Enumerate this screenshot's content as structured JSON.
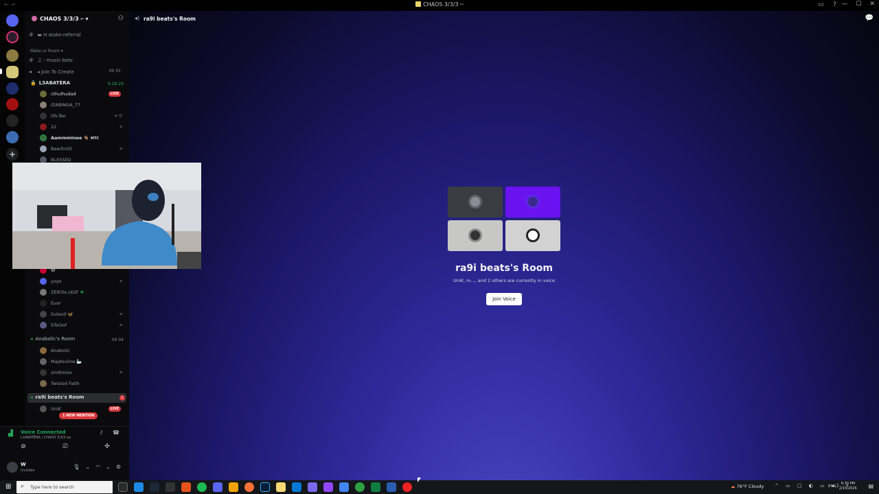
{
  "window": {
    "title": "CHAOS 3/3/3",
    "title_suffix": "ᵖˢ"
  },
  "server": {
    "name": "CHAOS 3/3/3",
    "name_suffix": "ᵖˢ",
    "channels": [
      {
        "icon": "#",
        "label": "stake-referral",
        "prefix": "H"
      },
      {
        "category": "Make ur Room"
      },
      {
        "icon": "#",
        "label": "music-bots"
      },
      {
        "icon": "speaker",
        "label": "Join To Create",
        "counts": "00 01"
      }
    ],
    "voice_channels": [
      {
        "name": "L3ABATÉRA",
        "timer": "9:28:29",
        "members": [
          {
            "name": "cthulhudad",
            "live": "LIVE"
          },
          {
            "name": "IZABINGA_77"
          },
          {
            "name": "Oh-Teo"
          },
          {
            "name": "22"
          },
          {
            "name": "Aammminee",
            "tag": "MTC"
          },
          {
            "name": "Beerlin05"
          },
          {
            "name": "BLESSED"
          },
          {
            "name": "W"
          },
          {
            "name": "yoyo"
          },
          {
            "name": "ZERI3a LKiiF"
          },
          {
            "name": "Evor"
          },
          {
            "name": "Sulaxd"
          },
          {
            "name": "STeOoF"
          }
        ]
      },
      {
        "name": "Anabolic's Room",
        "counts": "04 04",
        "members": [
          {
            "name": "Anabolic"
          },
          {
            "name": "Majdouline"
          },
          {
            "name": "slndimiso"
          },
          {
            "name": "Twisted Faith"
          }
        ]
      },
      {
        "name": "ra9i beats's Room",
        "badge": "1",
        "members": [
          {
            "name": "UniK",
            "live": "LIVE"
          }
        ],
        "mention": "1 NEW MENTION"
      }
    ]
  },
  "voice_panel": {
    "status": "Voice Connected",
    "location": "L3ABATÉRA / CHAOS 3/3/3 ps"
  },
  "user": {
    "name": "W",
    "status": "Invisible"
  },
  "main": {
    "channel_name": "ra9i beats's Room",
    "room_title": "ra9i beats's Room",
    "room_subtitle": "UniK, m..., and 2 others are currently in voice",
    "join_button": "Join Voice"
  },
  "taskbar": {
    "search_placeholder": "Type here to search",
    "weather": "76°F  Cloudy",
    "lang": "ENG",
    "time": "6:30 PM",
    "date": "2/15/2026"
  },
  "colors": {
    "accent_green": "#23a55a",
    "live_red": "#da373c",
    "tile_purple": "#6b12f0"
  }
}
